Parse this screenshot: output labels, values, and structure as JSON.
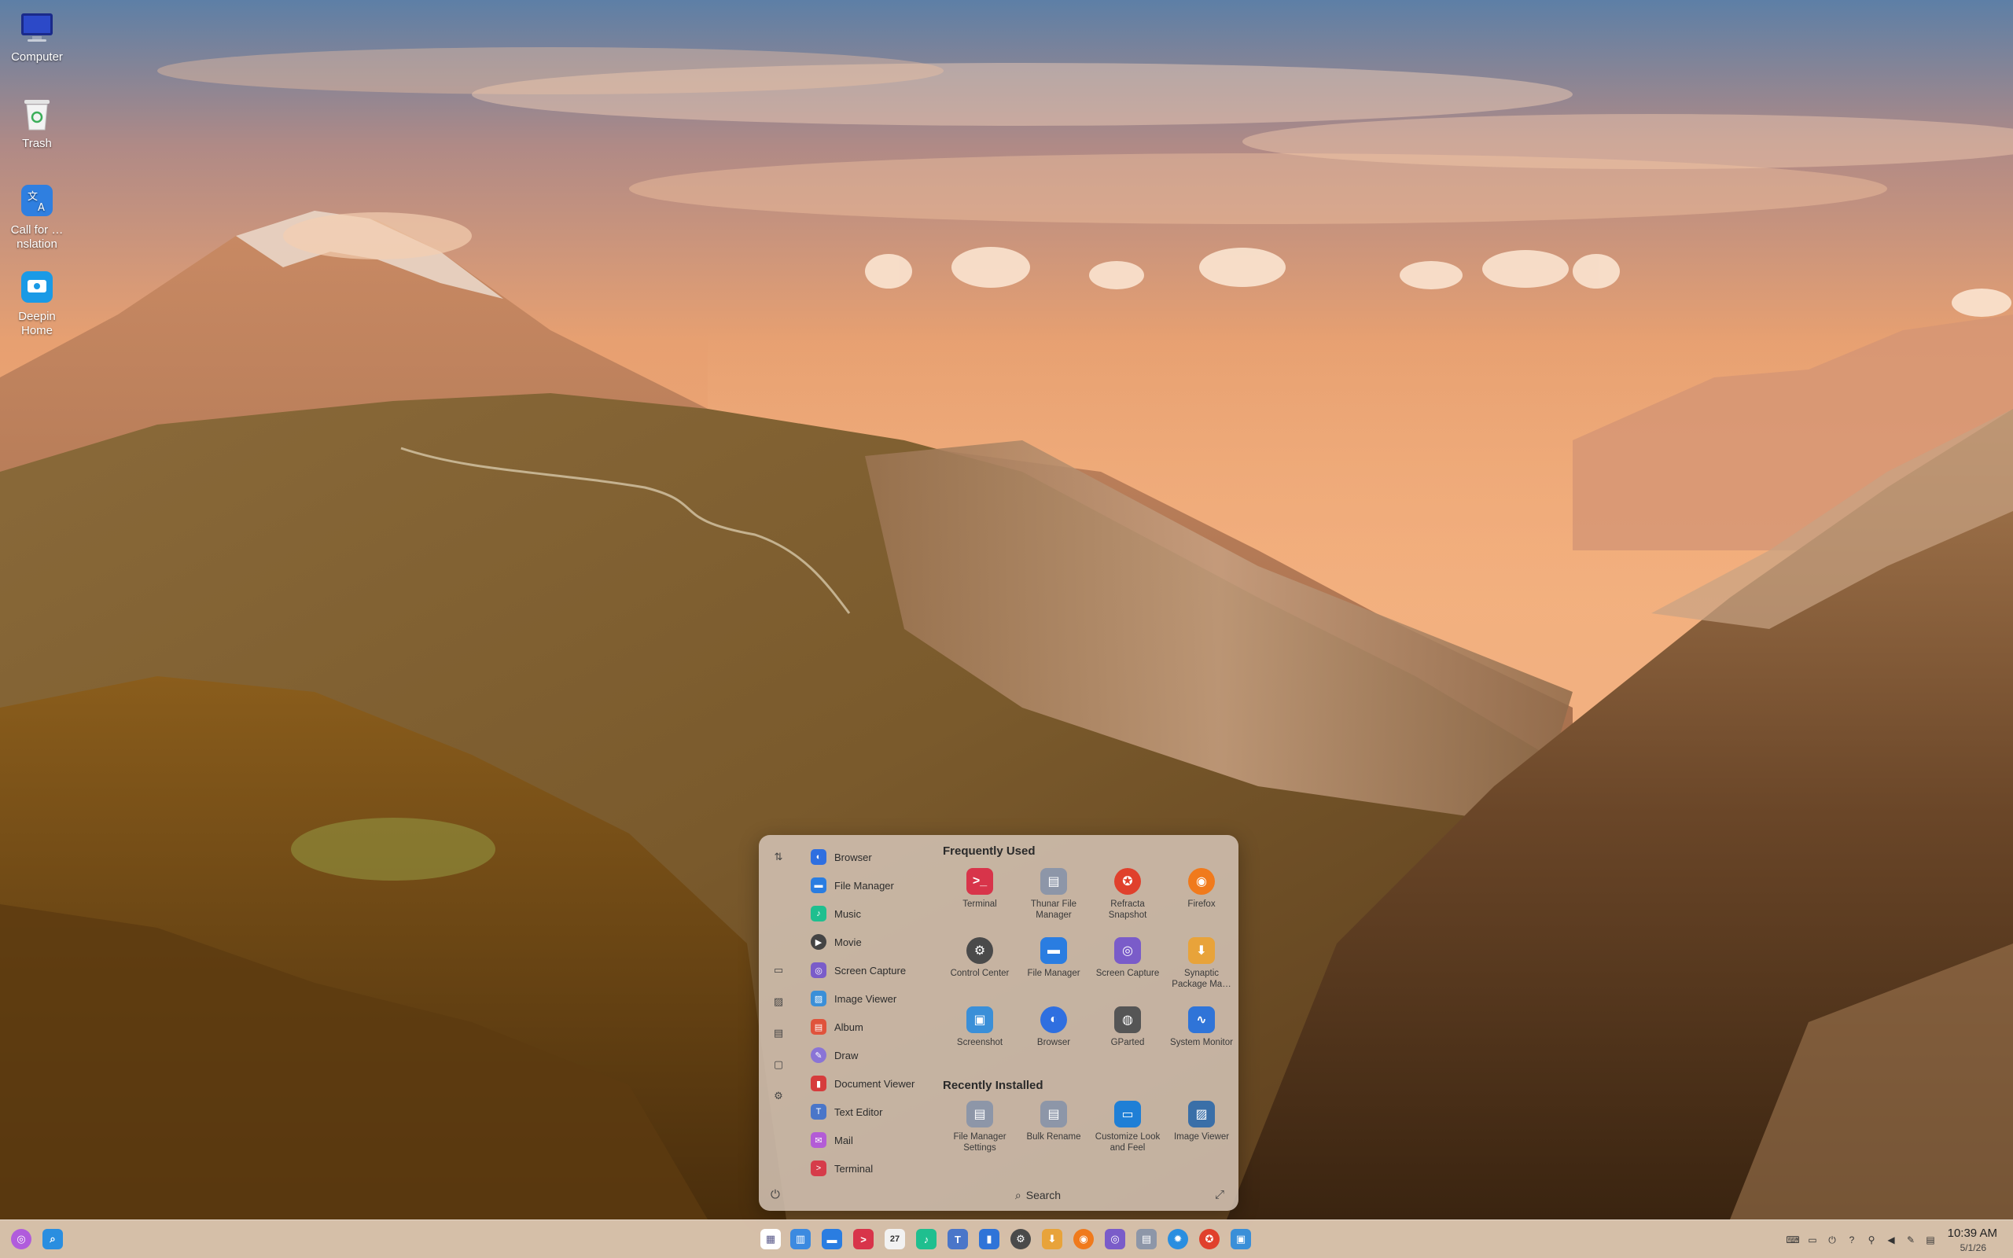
{
  "desktop": {
    "icons": [
      {
        "label": "Computer",
        "icon": "computer-icon"
      },
      {
        "label": "Trash",
        "icon": "trash-icon"
      },
      {
        "label": "Call for …nslation",
        "icon": "translation-icon"
      },
      {
        "label": "Deepin Home",
        "icon": "deepin-home-icon"
      }
    ]
  },
  "launcher": {
    "app_list": [
      {
        "label": "Browser",
        "icon": "browser-icon",
        "color": "#2f6fe0"
      },
      {
        "label": "File Manager",
        "icon": "folder-icon",
        "color": "#2a7de1"
      },
      {
        "label": "Music",
        "icon": "music-icon",
        "color": "#1fbf8f"
      },
      {
        "label": "Movie",
        "icon": "movie-icon",
        "color": "#444444"
      },
      {
        "label": "Screen Capture",
        "icon": "camera-icon",
        "color": "#7a5cc9"
      },
      {
        "label": "Image Viewer",
        "icon": "image-icon",
        "color": "#3a8fd8"
      },
      {
        "label": "Album",
        "icon": "album-icon",
        "color": "#e0533c"
      },
      {
        "label": "Draw",
        "icon": "draw-icon",
        "color": "#8a74d6"
      },
      {
        "label": "Document Viewer",
        "icon": "document-icon",
        "color": "#d63c3c"
      },
      {
        "label": "Text Editor",
        "icon": "text-editor-icon",
        "color": "#4a76c9"
      },
      {
        "label": "Mail",
        "icon": "mail-icon",
        "color": "#b35cd6"
      },
      {
        "label": "Terminal",
        "icon": "terminal-icon",
        "color": "#d63c4a"
      }
    ],
    "frequently_used_title": "Frequently Used",
    "frequently_used": [
      {
        "label": "Terminal",
        "icon": "terminal-icon",
        "glyph": ">_",
        "color": "#d8344a"
      },
      {
        "label": "Thunar File Manager",
        "icon": "thunar-icon",
        "glyph": "▤",
        "color": "#8d96a8"
      },
      {
        "label": "Refracta Snapshot",
        "icon": "refracta-icon",
        "glyph": "✪",
        "color": "#e0402c"
      },
      {
        "label": "Firefox",
        "icon": "firefox-icon",
        "glyph": "◉",
        "color": "#f07a1c"
      },
      {
        "label": "Control Center",
        "icon": "gear-icon",
        "glyph": "⚙",
        "color": "#4a4a4a"
      },
      {
        "label": "File Manager",
        "icon": "folder-icon",
        "glyph": "▬",
        "color": "#2a7de1"
      },
      {
        "label": "Screen Capture",
        "icon": "camera-icon",
        "glyph": "◎",
        "color": "#7a5cc9"
      },
      {
        "label": "Synaptic Package Ma…",
        "icon": "synaptic-icon",
        "glyph": "⬇",
        "color": "#e8a33a"
      },
      {
        "label": "Screenshot",
        "icon": "screenshot-icon",
        "glyph": "▣",
        "color": "#3a8fd8"
      },
      {
        "label": "Browser",
        "icon": "browser-icon",
        "glyph": "◐",
        "color": "#2f6fe0"
      },
      {
        "label": "GParted",
        "icon": "gparted-icon",
        "glyph": "◍",
        "color": "#555555"
      },
      {
        "label": "System Monitor",
        "icon": "system-monitor-icon",
        "glyph": "∿",
        "color": "#2f74d8"
      }
    ],
    "recently_installed_title": "Recently Installed",
    "recently_installed": [
      {
        "label": "File Manager Settings",
        "icon": "thunar-settings-icon",
        "glyph": "▤",
        "color": "#8d96a8"
      },
      {
        "label": "Bulk Rename",
        "icon": "bulk-rename-icon",
        "glyph": "▤",
        "color": "#8d96a8"
      },
      {
        "label": "Customize Look and Feel",
        "icon": "appearance-icon",
        "glyph": "▭",
        "color": "#1f7fd6"
      },
      {
        "label": "Image Viewer",
        "icon": "image-icon",
        "glyph": "▨",
        "color": "#3a6fa8"
      }
    ],
    "search_label": "Search"
  },
  "taskbar": {
    "left": [
      {
        "name": "deepin-launcher-icon",
        "glyph": "◎",
        "color": "#b05cdc"
      },
      {
        "name": "search-icon",
        "glyph": "⌕",
        "color": "#2a8ee0"
      }
    ],
    "center": [
      {
        "name": "launcher-grid-icon",
        "glyph": "▦",
        "color": "#ffffff"
      },
      {
        "name": "multitask-icon",
        "glyph": "▥",
        "color": "#3c8ae0"
      },
      {
        "name": "file-manager-icon",
        "glyph": "▬",
        "color": "#2a7de1"
      },
      {
        "name": "terminal-icon",
        "glyph": ">",
        "color": "#d8344a"
      },
      {
        "name": "calendar-icon",
        "glyph": "27",
        "color": "#f2f2f2"
      },
      {
        "name": "music-icon",
        "glyph": "♪",
        "color": "#1fbf8f"
      },
      {
        "name": "text-editor-icon",
        "glyph": "T",
        "color": "#4a76c9"
      },
      {
        "name": "control-center-panel-icon",
        "glyph": "▮",
        "color": "#2f74d8"
      },
      {
        "name": "gear-icon",
        "glyph": "⚙",
        "color": "#4a4a4a"
      },
      {
        "name": "synaptic-icon",
        "glyph": "⬇",
        "color": "#e8a33a"
      },
      {
        "name": "firefox-icon",
        "glyph": "◉",
        "color": "#f07a1c"
      },
      {
        "name": "screen-capture-icon",
        "glyph": "◎",
        "color": "#7a5cc9"
      },
      {
        "name": "thunar-icon",
        "glyph": "▤",
        "color": "#8d96a8"
      },
      {
        "name": "settings-blue-icon",
        "glyph": "✹",
        "color": "#2a8ee0"
      },
      {
        "name": "refracta-icon",
        "glyph": "✪",
        "color": "#e0402c"
      },
      {
        "name": "screenshot-icon",
        "glyph": "▣",
        "color": "#3a8fd8"
      }
    ],
    "tray": [
      {
        "name": "keyboard-icon",
        "glyph": "⌨"
      },
      {
        "name": "battery-icon",
        "glyph": "▭"
      },
      {
        "name": "power-tray-icon",
        "glyph": "⏻"
      },
      {
        "name": "help-icon",
        "glyph": "?"
      },
      {
        "name": "usb-icon",
        "glyph": "⚲"
      },
      {
        "name": "volume-icon",
        "glyph": "◀"
      },
      {
        "name": "pen-icon",
        "glyph": "✎"
      },
      {
        "name": "notification-icon",
        "glyph": "▤"
      }
    ],
    "time": "10:39 AM",
    "date": "5/1/26"
  }
}
